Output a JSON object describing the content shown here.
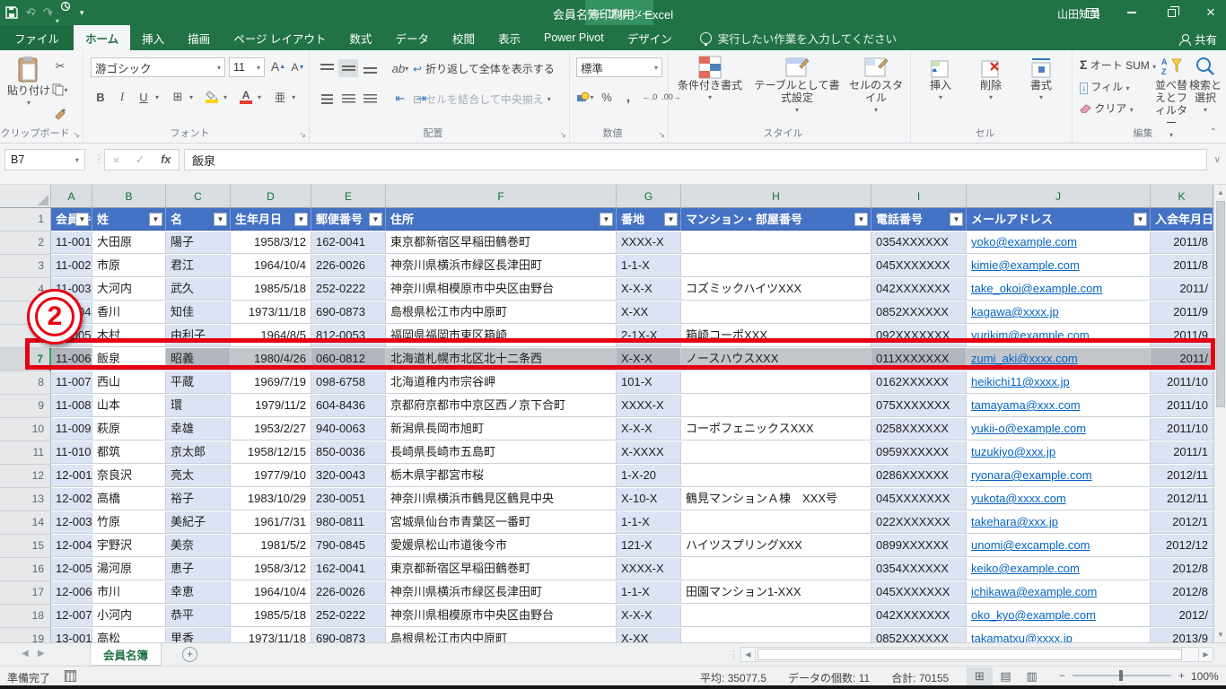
{
  "titlebar": {
    "title": "会員名簿印刷用 - Excel",
    "contextual_label": "テーブル ツール",
    "user_name": "山田知美"
  },
  "ribbon_tabs": [
    {
      "label": "ファイル"
    },
    {
      "label": "ホーム"
    },
    {
      "label": "挿入"
    },
    {
      "label": "描画"
    },
    {
      "label": "ページ レイアウト"
    },
    {
      "label": "数式"
    },
    {
      "label": "データ"
    },
    {
      "label": "校閲"
    },
    {
      "label": "表示"
    },
    {
      "label": "Power Pivot"
    },
    {
      "label": "デザイン"
    }
  ],
  "tellme": {
    "text": "実行したい作業を入力してください"
  },
  "share_label": "共有",
  "ribbon": {
    "clipboard": {
      "paste": "貼り付け",
      "group": "クリップボード"
    },
    "font": {
      "font_name": "游ゴシック",
      "font_size": "11",
      "bold": "B",
      "italic": "I",
      "underline": "U",
      "ruby": "亜",
      "group": "フォント"
    },
    "alignment": {
      "wrap": "折り返して全体を表示する",
      "merge": "セルを結合して中央揃え",
      "group": "配置"
    },
    "number": {
      "format": "標準",
      "group": "数値"
    },
    "styles": {
      "conditional": "条件付き書式",
      "format_table": "テーブルとして書式設定",
      "cell_styles": "セルのスタイル",
      "group": "スタイル"
    },
    "cells": {
      "insert": "挿入",
      "delete": "削除",
      "format": "書式",
      "group": "セル"
    },
    "editing": {
      "autosum": "オート SUM",
      "fill": "フィル",
      "clear": "クリア",
      "sort": "並べ替えとフィルター",
      "find": "検索と選択",
      "group": "編集"
    }
  },
  "formula_bar": {
    "name_box": "B7",
    "value": "飯泉"
  },
  "grid": {
    "column_letters": [
      "A",
      "B",
      "C",
      "D",
      "E",
      "F",
      "G",
      "H",
      "I",
      "J",
      "K"
    ],
    "header_row": [
      "会員番号",
      "姓",
      "名",
      "生年月日",
      "郵便番号",
      "住所",
      "番地",
      "マンション・部屋番号",
      "電話番号",
      "メールアドレス",
      "入会年月日"
    ],
    "selected_row_number": "7",
    "annotation_number": "2",
    "rows": [
      {
        "n": "2",
        "c": [
          "11-001",
          "大田原",
          "陽子",
          "1958/3/12",
          "162-0041",
          "東京都新宿区早稲田鶴巻町",
          "XXXX-X",
          "",
          "0354XXXXXX",
          "yoko@example.com",
          "2011/8"
        ]
      },
      {
        "n": "3",
        "c": [
          "11-002",
          "市原",
          "君江",
          "1964/10/4",
          "226-0026",
          "神奈川県横浜市緑区長津田町",
          "1-1-X",
          "",
          "045XXXXXXX",
          "kimie@example.com",
          "2011/8"
        ]
      },
      {
        "n": "4",
        "c": [
          "11-003",
          "大河内",
          "武久",
          "1985/5/18",
          "252-0222",
          "神奈川県相模原市中央区由野台",
          "X-X-X",
          "コズミックハイツXXX",
          "042XXXXXXX",
          "take_okoi@example.com",
          "2011/"
        ]
      },
      {
        "n": "5",
        "c": [
          "11-004",
          "香川",
          "知佳",
          "1973/11/18",
          "690-0873",
          "島根県松江市内中原町",
          "X-XX",
          "",
          "0852XXXXXX",
          "kagawa@xxxx.jp",
          "2011/9"
        ]
      },
      {
        "n": "6",
        "c": [
          "11-005",
          "木村",
          "由利子",
          "1964/8/5",
          "812-0053",
          "福岡県福岡市東区箱崎",
          "2-1X-X",
          "箱崎コーポXXX",
          "092XXXXXXX",
          "yurikim@example.com",
          "2011/9"
        ]
      },
      {
        "n": "7",
        "c": [
          "11-006",
          "飯泉",
          "昭義",
          "1980/4/26",
          "060-0812",
          "北海道札幌市北区北十二条西",
          "X-X-X",
          "ノースハウスXXX",
          "011XXXXXXX",
          "zumi_aki@xxxx.com",
          "2011/"
        ]
      },
      {
        "n": "8",
        "c": [
          "11-007",
          "西山",
          "平蔵",
          "1969/7/19",
          "098-6758",
          "北海道稚内市宗谷岬",
          "101-X",
          "",
          "0162XXXXXX",
          "heikichi11@xxxx.jp",
          "2011/10"
        ]
      },
      {
        "n": "9",
        "c": [
          "11-008",
          "山本",
          "環",
          "1979/11/2",
          "604-8436",
          "京都府京都市中京区西ノ京下合町",
          "XXXX-X",
          "",
          "075XXXXXXX",
          "tamayama@xxx.com",
          "2011/10"
        ]
      },
      {
        "n": "10",
        "c": [
          "11-009",
          "萩原",
          "幸雄",
          "1953/2/27",
          "940-0063",
          "新潟県長岡市旭町",
          "X-X-X",
          "コーポフェニックスXXX",
          "0258XXXXXX",
          "yukii-o@example.com",
          "2011/10"
        ]
      },
      {
        "n": "11",
        "c": [
          "11-010",
          "都筑",
          "京太郎",
          "1958/12/15",
          "850-0036",
          "長崎県長崎市五島町",
          "X-XXXX",
          "",
          "0959XXXXXX",
          "tuzukiyo@xxx.jp",
          "2011/1"
        ]
      },
      {
        "n": "12",
        "c": [
          "12-001",
          "奈良沢",
          "亮太",
          "1977/9/10",
          "320-0043",
          "栃木県宇都宮市桜",
          "1-X-20",
          "",
          "0286XXXXXX",
          "ryonara@example.com",
          "2012/11"
        ]
      },
      {
        "n": "13",
        "c": [
          "12-002",
          "高橋",
          "裕子",
          "1983/10/29",
          "230-0051",
          "神奈川県横浜市鶴見区鶴見中央",
          "X-10-X",
          "鶴見マンションＡ棟　XXX号",
          "045XXXXXXX",
          "yukota@xxxx.com",
          "2012/11"
        ]
      },
      {
        "n": "14",
        "c": [
          "12-003",
          "竹原",
          "美紀子",
          "1961/7/31",
          "980-0811",
          "宮城県仙台市青葉区一番町",
          "1-1-X",
          "",
          "022XXXXXXX",
          "takehara@xxx.jp",
          "2012/1"
        ]
      },
      {
        "n": "15",
        "c": [
          "12-004",
          "宇野沢",
          "美奈",
          "1981/5/2",
          "790-0845",
          "愛媛県松山市道後今市",
          "121-X",
          "ハイツスプリングXXX",
          "0899XXXXXX",
          "unomi@excample.com",
          "2012/12"
        ]
      },
      {
        "n": "16",
        "c": [
          "12-005",
          "湯河原",
          "恵子",
          "1958/3/12",
          "162-0041",
          "東京都新宿区早稲田鶴巻町",
          "XXXX-X",
          "",
          "0354XXXXXX",
          "keiko@example.com",
          "2012/8"
        ]
      },
      {
        "n": "17",
        "c": [
          "12-006",
          "市川",
          "幸恵",
          "1964/10/4",
          "226-0026",
          "神奈川県横浜市緑区長津田町",
          "1-1-X",
          "田園マンション1-XXX",
          "045XXXXXXX",
          "ichikawa@example.com",
          "2012/8"
        ]
      },
      {
        "n": "18",
        "c": [
          "12-007",
          "小河内",
          "恭平",
          "1985/5/18",
          "252-0222",
          "神奈川県相模原市中央区由野台",
          "X-X-X",
          "",
          "042XXXXXXX",
          "oko_kyo@example.com",
          "2012/"
        ]
      },
      {
        "n": "19",
        "c": [
          "13-001",
          "高松",
          "里香",
          "1973/11/18",
          "690-0873",
          "島根県松江市内中原町",
          "X-XX",
          "",
          "0852XXXXXX",
          "takamatxu@xxxx.jp",
          "2013/9"
        ]
      }
    ]
  },
  "sheet": {
    "tab": "会員名簿"
  },
  "status": {
    "ready": "準備完了",
    "average": "平均: 35077.5",
    "count": "データの個数: 11",
    "sum": "合計: 70155",
    "zoom": "100%"
  }
}
